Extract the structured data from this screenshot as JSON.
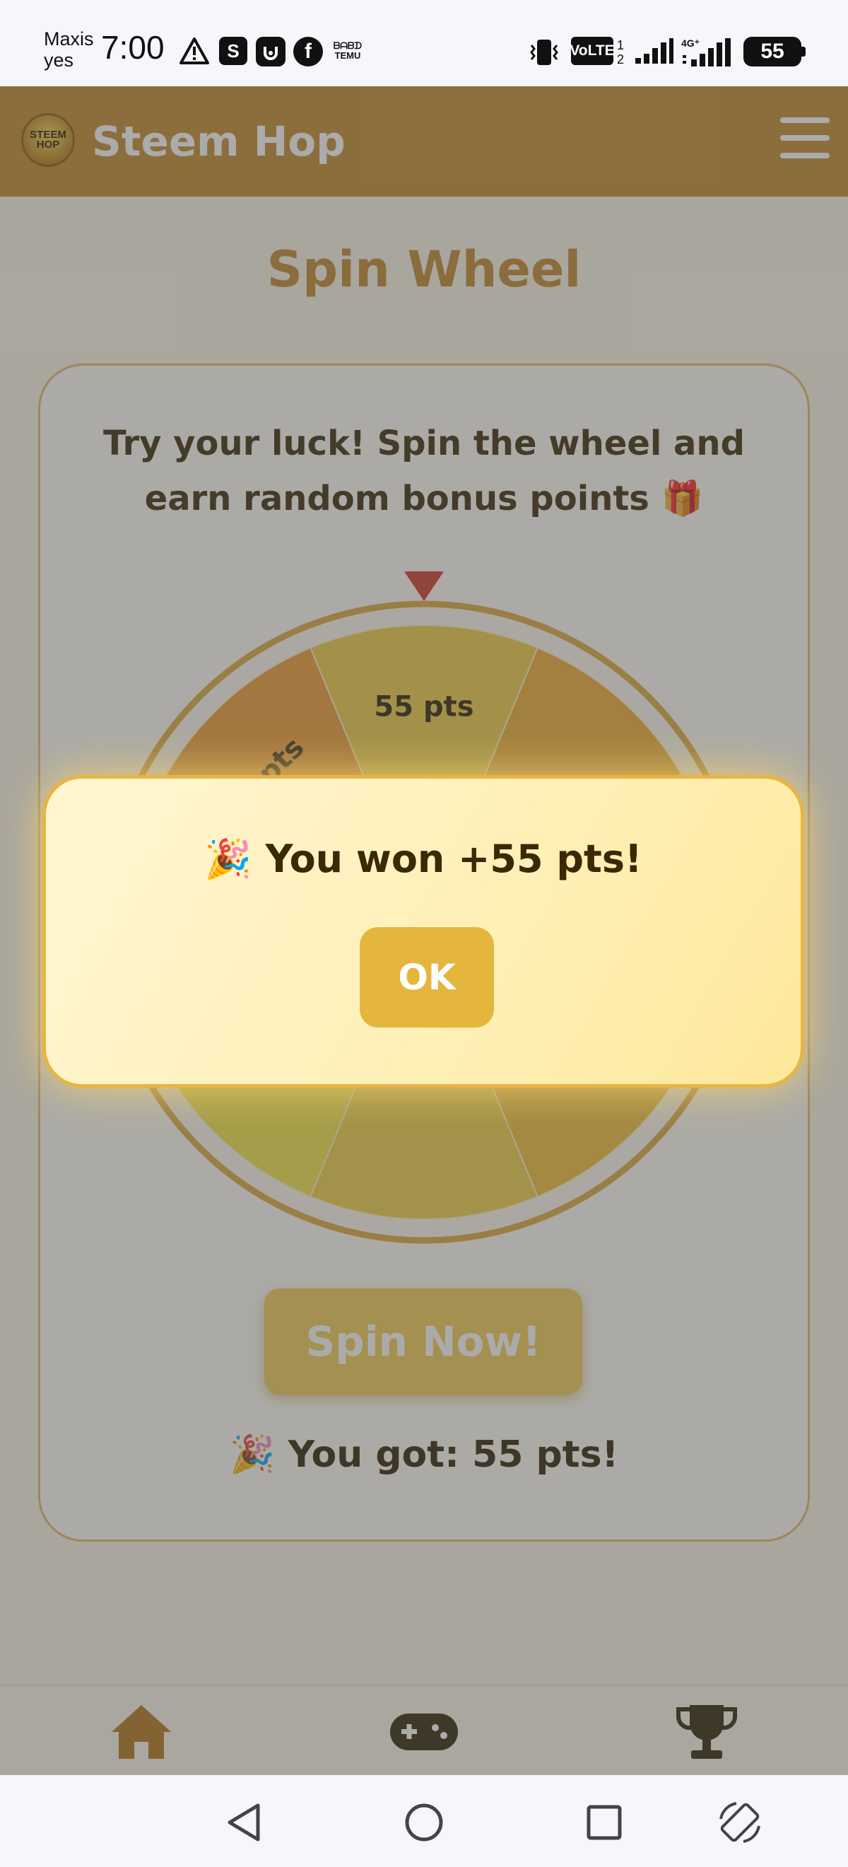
{
  "status_bar": {
    "carrier_line1": "Maxis",
    "carrier_line2": "yes",
    "time": "7:00",
    "shopee_glyph": "S",
    "facebook_glyph": "f",
    "temu_line1": "ᗷᗩᗷᗪ",
    "temu_line2": "TEMU",
    "volte": "VoLTE",
    "sim1": "1",
    "sim2": "2",
    "network": "4G⁺",
    "battery": "55",
    "icons": [
      "warning-icon",
      "shopee-icon",
      "appu-icon",
      "facebook-icon",
      "temu-icon",
      "vibrate-icon",
      "volte-icon",
      "signal-icon",
      "4g-signal-icon",
      "battery-icon"
    ]
  },
  "app": {
    "title": "Steem Hop",
    "logo_text": "STEEM HOP",
    "brand_color": "#c48b2c"
  },
  "page": {
    "title": "Spin Wheel",
    "description_line1": "Try your luck! Spin the wheel and",
    "description_line2": "earn random bonus points 🎁",
    "spin_button": "Spin Now!",
    "result": "🎉 You got: 55 pts!"
  },
  "wheel": {
    "segment_labels": [
      "55 pts",
      "",
      "",
      "",
      "",
      "",
      "",
      "? pts"
    ],
    "segment_colors": [
      "#f0cd46",
      "#efac30",
      "#f3c33e",
      "#f2be36",
      "#efd043",
      "#f6e446",
      "#f2ba37",
      "#ee9e32"
    ],
    "pointer_color": "#d23a2c"
  },
  "modal": {
    "message": "🎉 You won +55 pts!",
    "ok_label": "OK"
  },
  "bottom_nav": {
    "items": [
      "home-icon",
      "gamepad-icon",
      "trophy-icon"
    ]
  },
  "system_nav": {
    "items": [
      "back-icon",
      "home-circle-icon",
      "recents-icon",
      "rotate-icon"
    ]
  }
}
